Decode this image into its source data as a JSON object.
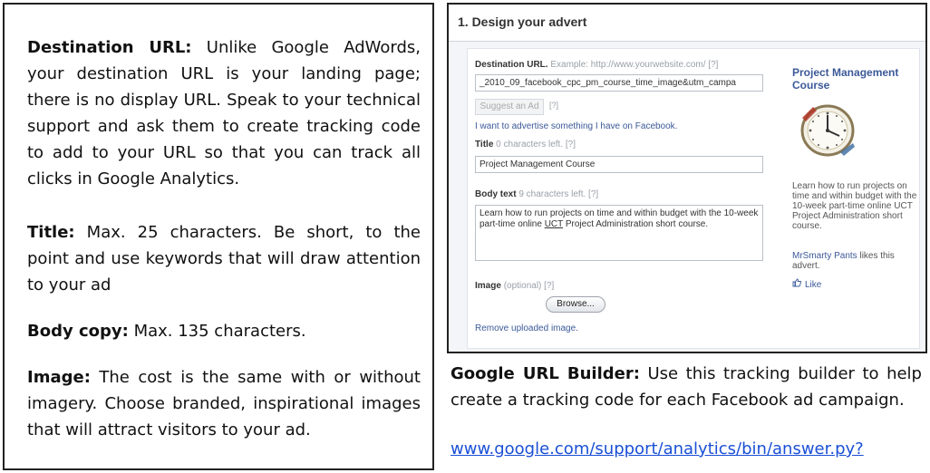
{
  "left": {
    "destination": {
      "label": "Destination URL:",
      "text": "Unlike Google AdWords, your destination URL is your landing page; there is no display URL. Speak to your technical support and ask them to create tracking code to add to your URL so that you can track all clicks in Google Analytics."
    },
    "title": {
      "label": "Title:",
      "text": "Max. 25 characters. Be short, to the point and use keywords that will draw attention to your ad"
    },
    "body_copy": {
      "label": "Body copy:",
      "text": "Max. 135 characters."
    },
    "image": {
      "label": "Image:",
      "text": "The cost is the same with or without imagery. Choose branded, inspirational images that will attract visitors to your ad."
    }
  },
  "screenshot": {
    "header": "1. Design your advert",
    "destination_label": "Destination URL.",
    "destination_hint": "Example: http://www.yourwebsite.com/",
    "help": "[?]",
    "destination_value": "_2010_09_facebook_cpc_pm_course_time_image&utm_campa",
    "suggest_button": "Suggest an Ad",
    "facebook_link": "I want to advertise something I have on Facebook.",
    "title_label": "Title",
    "title_hint": "0 characters left.",
    "title_value": "Project Management Course",
    "body_label": "Body text",
    "body_hint": "9 characters left.",
    "body_value_part1": "Learn how to run projects on time and within budget with the 10-week part-time online ",
    "body_value_underlined": "UCT",
    "body_value_part2": " Project Administration short course.",
    "image_label": "Image",
    "image_hint": "(optional)",
    "browse_button": "Browse...",
    "remove_link": "Remove uploaded image.",
    "preview": {
      "title": "Project Management Course",
      "body": "Learn how to run projects on time and within budget with the 10-week part-time online UCT Project Administration short course.",
      "liker_name": "MrSmarty Pants",
      "likes_text": " likes this advert.",
      "like_label": "Like"
    }
  },
  "below": {
    "label": "Google URL Builder:",
    "text": "Use this tracking builder to help create a tracking code for each Facebook ad campaign.",
    "url": "www.google.com/support/analytics/bin/answer.py?"
  },
  "colors": {
    "link_blue": "#3b5998",
    "hyperlink": "#1a4fd6",
    "border": "#222222"
  }
}
